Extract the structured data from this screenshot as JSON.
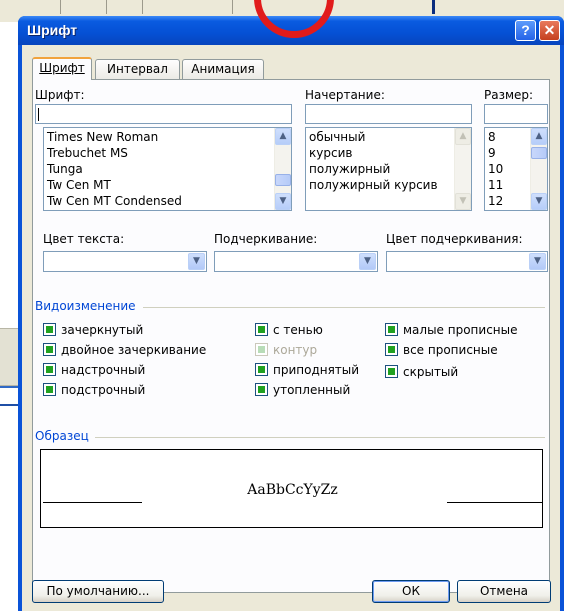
{
  "window": {
    "title": "Шрифт",
    "help_glyph": "?",
    "close_glyph": "✕"
  },
  "tabs": [
    {
      "label": "Шрифт",
      "active": true
    },
    {
      "label": "Интервал",
      "active": false
    },
    {
      "label": "Анимация",
      "active": false
    }
  ],
  "font": {
    "label": "Шрифт:",
    "value": "",
    "options": [
      "Times New Roman",
      "Trebuchet MS",
      "Tunga",
      "Tw Cen MT",
      "Tw Cen MT Condensed"
    ]
  },
  "style": {
    "label": "Начертание:",
    "value": "",
    "options": [
      "обычный",
      "курсив",
      "полужирный",
      "полужирный курсив"
    ]
  },
  "size": {
    "label": "Размер:",
    "value": "",
    "options": [
      "8",
      "9",
      "10",
      "11",
      "12"
    ]
  },
  "text_color": {
    "label": "Цвет текста:",
    "value": ""
  },
  "underline": {
    "label": "Подчеркивание:",
    "value": ""
  },
  "underline_color": {
    "label": "Цвет подчеркивания:",
    "value": ""
  },
  "effects": {
    "title": "Видоизменение",
    "col1": [
      "зачеркнутый",
      "двойное зачеркивание",
      "надстрочный",
      "подстрочный"
    ],
    "col2": [
      "с тенью",
      "контур",
      "приподнятый",
      "утопленный"
    ],
    "col3": [
      "малые прописные",
      "все прописные",
      "скрытый"
    ]
  },
  "preview": {
    "title": "Образец",
    "sample": "AaBbCcYyZz"
  },
  "buttons": {
    "default": "По умолчанию...",
    "ok": "ОК",
    "cancel": "Отмена"
  },
  "colors": {
    "titlebar": "#0550d4",
    "dialog_bg": "#ece9d8",
    "checkbox_check": "#21a121",
    "group_title": "#0046d5",
    "annotation_ring": "#e11b1b"
  }
}
